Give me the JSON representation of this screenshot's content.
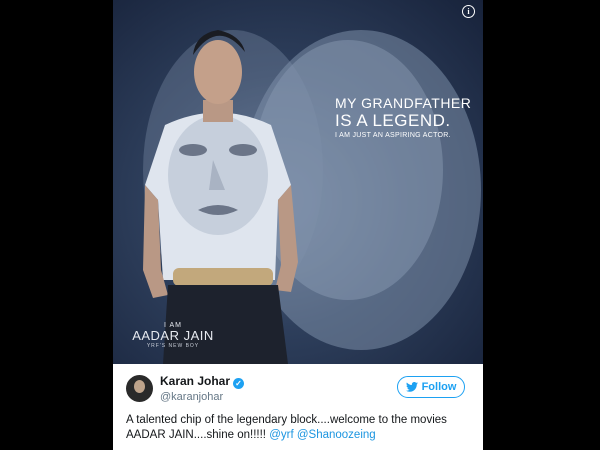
{
  "poster": {
    "info_icon": "i",
    "headline_line1": "MY GRANDFATHER",
    "headline_line2": "IS A LEGEND.",
    "subline": "I AM JUST AN ASPIRING ACTOR.",
    "name_prefix": "I AM",
    "name": "AADAR JAIN",
    "name_tag": "YRF'S NEW BOY"
  },
  "tweet": {
    "user_name": "Karan Johar",
    "handle": "@karanjohar",
    "verified_icon": "verified-badge",
    "follow_label": "Follow",
    "text": "A talented chip of the legendary block....welcome to the movies AADAR JAIN....shine on!!!!!",
    "mention1": "@yrf",
    "mention2": "@Shanoozeing"
  },
  "colors": {
    "twitter_blue": "#1da1f2",
    "mention_blue": "#1b95e0",
    "poster_bg": "#2e3f5c"
  }
}
